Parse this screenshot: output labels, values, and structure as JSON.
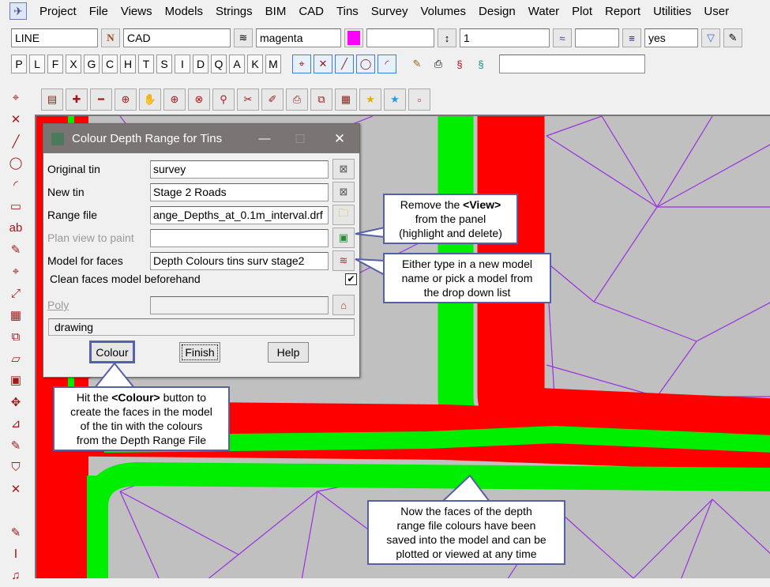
{
  "menu": [
    "Project",
    "File",
    "Views",
    "Models",
    "Strings",
    "BIM",
    "CAD",
    "Tins",
    "Survey",
    "Volumes",
    "Design",
    "Water",
    "Plot",
    "Report",
    "Utilities",
    "User"
  ],
  "toolbar": {
    "string_type": "LINE",
    "model": "CAD",
    "colour": "magenta",
    "colour_hex": "#ff00ff",
    "height": "",
    "weight": "1",
    "linestyle": "",
    "breakline": "yes"
  },
  "letters": [
    "P",
    "L",
    "F",
    "X",
    "G",
    "C",
    "H",
    "T",
    "S",
    "I",
    "D",
    "Q",
    "A",
    "K",
    "M"
  ],
  "dialog": {
    "title": "Colour Depth Range for Tins",
    "fields": [
      {
        "label": "Original tin",
        "value": "survey"
      },
      {
        "label": "New tin",
        "value": "Stage 2 Roads"
      },
      {
        "label": "Range file",
        "value": "ange_Depths_at_0.1m_interval.drf"
      },
      {
        "label": "Plan view to paint",
        "value": ""
      },
      {
        "label": "Model for faces",
        "value": "Depth Colours tins surv stage2"
      }
    ],
    "clean_label": "Clean faces model beforehand",
    "clean_checked": true,
    "poly_label": "Poly",
    "status": "drawing",
    "buttons": {
      "colour": "Colour",
      "finish": "Finish",
      "help": "Help"
    }
  },
  "callouts": {
    "view": [
      "Remove the ",
      "<View>",
      " from the panel",
      "(highlight and delete)"
    ],
    "model": [
      "Either type in a new model",
      "name or pick a model from",
      "the drop down list"
    ],
    "colour": [
      "Hit the ",
      "<Colour>",
      " button to",
      "create the faces in the model",
      "of the tin with the colours",
      "from the Depth Range File"
    ],
    "faces": [
      "Now the faces of the depth",
      "range file colours have been",
      "saved into the model and can be",
      "plotted or viewed at any time"
    ]
  },
  "colors": {
    "red": "#ff0000",
    "green": "#00ee00",
    "tri": "#9a30e0",
    "callout_border": "#5560a8"
  }
}
